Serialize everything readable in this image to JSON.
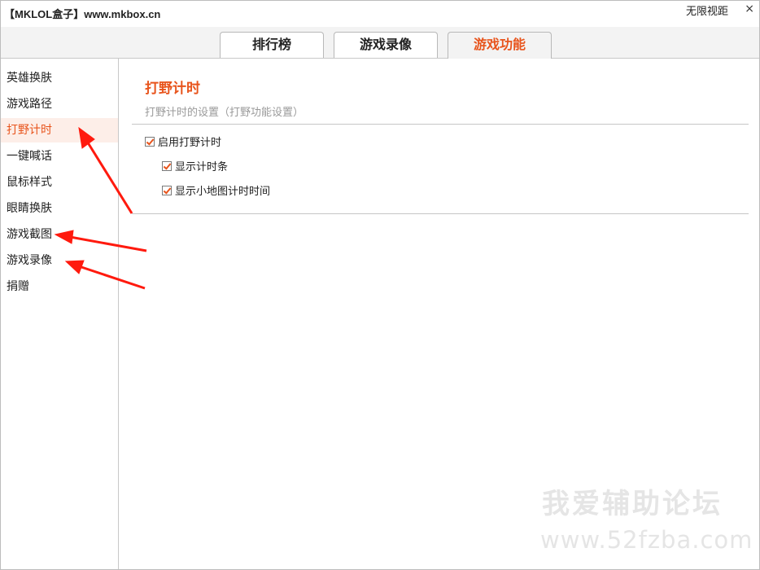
{
  "window": {
    "title": "【MKLOL盒子】www.mkbox.cn",
    "unlimited_view_label": "无限视距",
    "close_symbol": "×"
  },
  "tabs": [
    {
      "label": "排行榜",
      "active": false
    },
    {
      "label": "游戏录像",
      "active": false
    },
    {
      "label": "游戏功能",
      "active": true
    }
  ],
  "sidebar": {
    "items": [
      {
        "label": "英雄换肤",
        "active": false
      },
      {
        "label": "游戏路径",
        "active": false
      },
      {
        "label": "打野计时",
        "active": true
      },
      {
        "label": "一键喊话",
        "active": false
      },
      {
        "label": "鼠标样式",
        "active": false
      },
      {
        "label": "眼睛换肤",
        "active": false
      },
      {
        "label": "游戏截图",
        "active": false
      },
      {
        "label": "游戏录像",
        "active": false
      },
      {
        "label": "捐赠",
        "active": false
      }
    ]
  },
  "section": {
    "title": "打野计时",
    "description": "打野计时的设置（打野功能设置）",
    "options": [
      {
        "label": "启用打野计时",
        "checked": true
      },
      {
        "label": "显示计时条",
        "checked": true
      },
      {
        "label": "显示小地图计时时间",
        "checked": true
      }
    ]
  },
  "watermark": {
    "line1": "我爱辅助论坛",
    "line2": "www.52fzba.com"
  },
  "colors": {
    "accent": "#e8541c",
    "annotation_arrow": "#ff1a0e"
  }
}
